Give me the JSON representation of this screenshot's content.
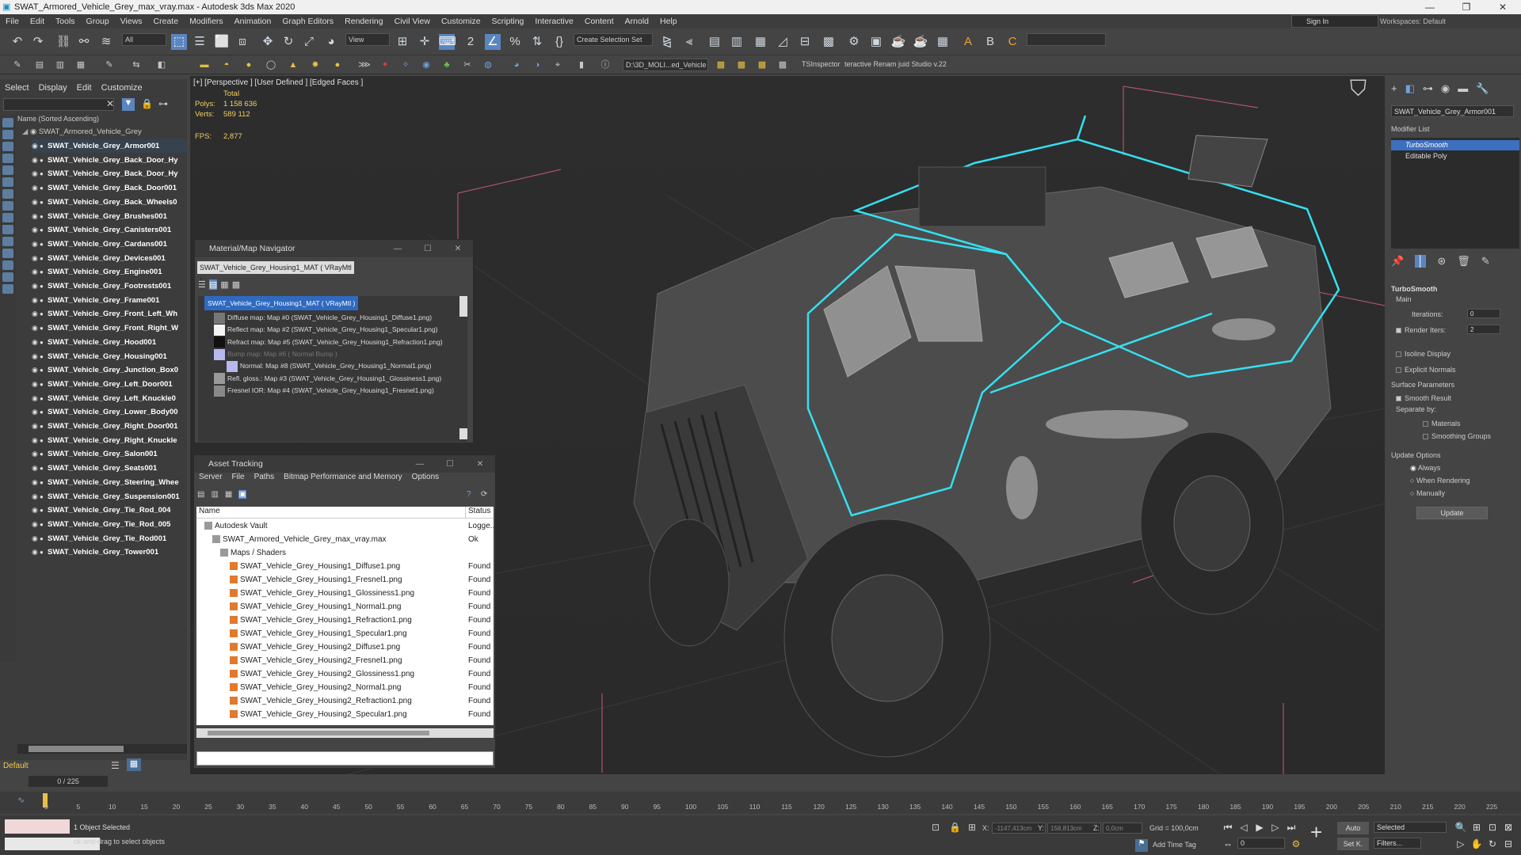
{
  "window": {
    "title": "SWAT_Armored_Vehicle_Grey_max_vray.max - Autodesk 3ds Max 2020"
  },
  "menu": [
    "File",
    "Edit",
    "Tools",
    "Group",
    "Views",
    "Create",
    "Modifiers",
    "Animation",
    "Graph Editors",
    "Rendering",
    "Civil View",
    "Customize",
    "Scripting",
    "Interactive",
    "Content",
    "Arnold",
    "Help"
  ],
  "account": {
    "signin": "Sign In",
    "workspaces_label": "Workspaces:",
    "workspace": "Default"
  },
  "toolbar": {
    "filter": "All",
    "refcoord": "View",
    "selset": "Create Selection Set",
    "path": "D:\\3D_MOLI...ed_Vehicle",
    "tsinspector": "TSInspector",
    "renamer": "teractive Renam juid Studio v.22"
  },
  "explorer": {
    "tabs": [
      "Select",
      "Display",
      "Edit",
      "Customize"
    ],
    "header": "Name (Sorted Ascending)",
    "root": "SWAT_Armored_Vehicle_Grey",
    "objects": [
      "SWAT_Vehicle_Grey_Armor001",
      "SWAT_Vehicle_Grey_Back_Door_Hy",
      "SWAT_Vehicle_Grey_Back_Door_Hy",
      "SWAT_Vehicle_Grey_Back_Door001",
      "SWAT_Vehicle_Grey_Back_Wheels0",
      "SWAT_Vehicle_Grey_Brushes001",
      "SWAT_Vehicle_Grey_Canisters001",
      "SWAT_Vehicle_Grey_Cardans001",
      "SWAT_Vehicle_Grey_Devices001",
      "SWAT_Vehicle_Grey_Engine001",
      "SWAT_Vehicle_Grey_Footrests001",
      "SWAT_Vehicle_Grey_Frame001",
      "SWAT_Vehicle_Grey_Front_Left_Wh",
      "SWAT_Vehicle_Grey_Front_Right_W",
      "SWAT_Vehicle_Grey_Hood001",
      "SWAT_Vehicle_Grey_Housing001",
      "SWAT_Vehicle_Grey_Junction_Box0",
      "SWAT_Vehicle_Grey_Left_Door001",
      "SWAT_Vehicle_Grey_Left_Knuckle0",
      "SWAT_Vehicle_Grey_Lower_Body00",
      "SWAT_Vehicle_Grey_Right_Door001",
      "SWAT_Vehicle_Grey_Right_Knuckle",
      "SWAT_Vehicle_Grey_Salon001",
      "SWAT_Vehicle_Grey_Seats001",
      "SWAT_Vehicle_Grey_Steering_Whee",
      "SWAT_Vehicle_Grey_Suspension001",
      "SWAT_Vehicle_Grey_Tie_Rod_004",
      "SWAT_Vehicle_Grey_Tie_Rod_005",
      "SWAT_Vehicle_Grey_Tie_Rod001",
      "SWAT_Vehicle_Grey_Tower001"
    ],
    "layer": "Default",
    "frame": "0 / 225"
  },
  "viewport": {
    "label": "[+] [Perspective ] [User Defined ] [Edged Faces ]",
    "stats_total": "Total",
    "polys_label": "Polys:",
    "polys": "1 158 636",
    "verts_label": "Verts:",
    "verts": "589 112",
    "fps_label": "FPS:",
    "fps": "2,877"
  },
  "matnav": {
    "title": "Material/Map Navigator",
    "field": "SWAT_Vehicle_Grey_Housing1_MAT  ( VRayMtl )",
    "root": "SWAT_Vehicle_Grey_Housing1_MAT  ( VRayMtl )",
    "maps": [
      "Diffuse map: Map #0 (SWAT_Vehicle_Grey_Housing1_Diffuse1.png)",
      "Reflect map: Map #2 (SWAT_Vehicle_Grey_Housing1_Specular1.png)",
      "Refract map: Map #5 (SWAT_Vehicle_Grey_Housing1_Refraction1.png)",
      "Bump map: Map #6  ( Normal Bump )",
      "Normal: Map #8 (SWAT_Vehicle_Grey_Housing1_Normal1.png)",
      "Refl. gloss.: Map #3 (SWAT_Vehicle_Grey_Housing1_Glossiness1.png)",
      "Fresnel IOR: Map #4 (SWAT_Vehicle_Grey_Housing1_Fresnel1.png)"
    ]
  },
  "asset": {
    "title": "Asset Tracking",
    "menu": [
      "Server",
      "File",
      "Paths",
      "Bitmap Performance and Memory",
      "Options"
    ],
    "col_name": "Name",
    "col_status": "Status",
    "rows": [
      {
        "name": "Autodesk Vault",
        "status": "Logge..."
      },
      {
        "name": "SWAT_Armored_Vehicle_Grey_max_vray.max",
        "status": "Ok"
      },
      {
        "name": "Maps / Shaders",
        "status": ""
      },
      {
        "name": "SWAT_Vehicle_Grey_Housing1_Diffuse1.png",
        "status": "Found"
      },
      {
        "name": "SWAT_Vehicle_Grey_Housing1_Fresnel1.png",
        "status": "Found"
      },
      {
        "name": "SWAT_Vehicle_Grey_Housing1_Glossiness1.png",
        "status": "Found"
      },
      {
        "name": "SWAT_Vehicle_Grey_Housing1_Normal1.png",
        "status": "Found"
      },
      {
        "name": "SWAT_Vehicle_Grey_Housing1_Refraction1.png",
        "status": "Found"
      },
      {
        "name": "SWAT_Vehicle_Grey_Housing1_Specular1.png",
        "status": "Found"
      },
      {
        "name": "SWAT_Vehicle_Grey_Housing2_Diffuse1.png",
        "status": "Found"
      },
      {
        "name": "SWAT_Vehicle_Grey_Housing2_Fresnel1.png",
        "status": "Found"
      },
      {
        "name": "SWAT_Vehicle_Grey_Housing2_Glossiness1.png",
        "status": "Found"
      },
      {
        "name": "SWAT_Vehicle_Grey_Housing2_Normal1.png",
        "status": "Found"
      },
      {
        "name": "SWAT_Vehicle_Grey_Housing2_Refraction1.png",
        "status": "Found"
      },
      {
        "name": "SWAT_Vehicle_Grey_Housing2_Specular1.png",
        "status": "Found"
      }
    ]
  },
  "command": {
    "object_name": "SWAT_Vehicle_Grey_Armor001",
    "modifier_list": "Modifier List",
    "stack": [
      "TurboSmooth",
      "Editable Poly"
    ],
    "ts_title": "TurboSmooth",
    "main": "Main",
    "iterations_label": "Iterations:",
    "iterations": "0",
    "render_iters_label": "Render Iters:",
    "render_iters": "2",
    "isoline": "Isoline Display",
    "explicit": "Explicit Normals",
    "surface": "Surface Parameters",
    "smooth_result": "Smooth Result",
    "separate_by": "Separate by:",
    "materials": "Materials",
    "smoothing_groups": "Smoothing Groups",
    "update_options": "Update Options",
    "always": "Always",
    "when_rendering": "When Rendering",
    "manually": "Manually",
    "update_btn": "Update"
  },
  "timeline": {
    "ticks": [
      "0",
      "5",
      "10",
      "15",
      "20",
      "25",
      "30",
      "35",
      "40",
      "45",
      "50",
      "55",
      "60",
      "65",
      "70",
      "75",
      "80",
      "85",
      "90",
      "95",
      "100",
      "105",
      "110",
      "115",
      "120",
      "125",
      "130",
      "135",
      "140",
      "145",
      "150",
      "155",
      "160",
      "165",
      "170",
      "175",
      "180",
      "185",
      "190",
      "195",
      "200",
      "205",
      "210",
      "215",
      "220",
      "225"
    ]
  },
  "status": {
    "selected": "1 Object Selected",
    "prompt": "ck-and-drag to select objects",
    "x_label": "X:",
    "x": "-1147,413cm",
    "y_label": "Y:",
    "y": "158,813cm",
    "z_label": "Z:",
    "z": "0,0cm",
    "grid": "Grid = 100,0cm",
    "add_time_tag": "Add Time Tag",
    "auto": "Auto",
    "setk": "Set K.",
    "selected_dd": "Selected",
    "frame_val": "0",
    "filters": "Filters..."
  },
  "colors": {
    "accent": "#3d6fbf",
    "wire": "#34e0f0",
    "stats": "#f0d060"
  }
}
